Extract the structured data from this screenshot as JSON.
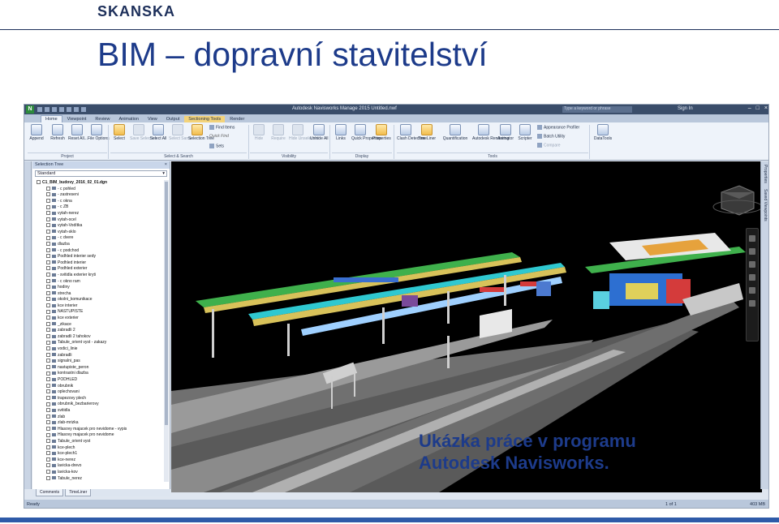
{
  "slide": {
    "logo": "SKANSKA",
    "title": "BIM – dopravní stavitelství",
    "caption_line1": "Ukázka práce v programu",
    "caption_line2": "Autodesk Navisworks.",
    "accent_color": "#1d3b8a"
  },
  "app": {
    "window_title": "Autodesk Navisworks Manage 2015   Untitled.nwf",
    "search_placeholder": "Type a keyword or phrase",
    "sign_in": "Sign In",
    "tabs": [
      "Home",
      "Viewpoint",
      "Review",
      "Animation",
      "View",
      "Output",
      "Sectioning Tools",
      "Render"
    ],
    "active_tab": "Home",
    "ribbon": {
      "buttons": [
        {
          "label": "Append",
          "state": "normal"
        },
        {
          "label": "Refresh",
          "state": "normal"
        },
        {
          "label": "Reset All...",
          "state": "normal"
        },
        {
          "label": "File Options",
          "state": "normal"
        },
        {
          "label": "Select",
          "state": "selected"
        },
        {
          "label": "Save Selection",
          "state": "dim"
        },
        {
          "label": "Select All",
          "state": "normal"
        },
        {
          "label": "Select Same",
          "state": "dim"
        },
        {
          "label": "Selection Tree",
          "state": "selected"
        },
        {
          "label": "Hide",
          "state": "dim"
        },
        {
          "label": "Require",
          "state": "dim"
        },
        {
          "label": "Hide Unselected",
          "state": "dim"
        },
        {
          "label": "Unhide All",
          "state": "normal"
        },
        {
          "label": "Links",
          "state": "normal"
        },
        {
          "label": "Quick Properties",
          "state": "normal"
        },
        {
          "label": "Properties",
          "state": "selected"
        },
        {
          "label": "Clash Detective",
          "state": "normal"
        },
        {
          "label": "TimeLiner",
          "state": "selected"
        },
        {
          "label": "Quantification",
          "state": "normal"
        },
        {
          "label": "Autodesk Rendering",
          "state": "normal"
        },
        {
          "label": "Animator",
          "state": "normal"
        },
        {
          "label": "Scripter",
          "state": "normal"
        },
        {
          "label": "DataTools",
          "state": "normal"
        }
      ],
      "find_items": "Find Items",
      "quick_find": "Quick Find",
      "sets": "Sets",
      "appearance_profiler": "Appearance Profiler",
      "batch_utility": "Batch Utility",
      "compare": "Compare",
      "groups": [
        "Project",
        "Select & Search",
        "Visibility",
        "Display",
        "Tools"
      ]
    },
    "selection_tree": {
      "header": "Selection Tree",
      "dropdown_value": "Standard",
      "root": "C1_BIM_budovy_2016_02_01.dgn",
      "items": [
        "- c pohled",
        "- zastreseni",
        "- c okna",
        "- c ZB",
        "vytah-nerez",
        "vytah-ocel",
        "vytah-Vodítka",
        "vytah-sklo",
        "- c dvere",
        "dlazba",
        "- c podchod",
        "Podhled interier sedy",
        "Podhled interier",
        "Podhled exterier",
        "- svitidla exterier kryti",
        "- c okno ram",
        "hodiny",
        "strecha",
        "okolni_komunikace",
        "kce interier",
        "NASTUPISTE",
        "kce exterier",
        "_zikace",
        "zabradli 2",
        "zabradli 2 tahokov",
        "Tabule_orient vyst - zakazy",
        "vodici_linie",
        "zabradli",
        "signalni_pas",
        "nastupiste_peron",
        "kontrastni dlazba",
        "PODHLED",
        "obrubnik",
        "oplechovani",
        "trapezovy plech",
        "obrubnik_bezbarierovy",
        "svitidla",
        "zlab",
        "zlab-mrizka",
        "Hlasovy majacek pro nevidome - vypis",
        "Hlasovy majacek pro nevidome",
        "Tabule_orient vyst",
        "kce-plech",
        "kce-plech1",
        "kce-nerez",
        "lavicka-drevo",
        "lavicka-kov",
        "Tabule_nerez"
      ]
    },
    "bottom_tabs": [
      "Comments",
      "TimeLiner"
    ],
    "right_tabs": [
      "Properties",
      "Saved Viewpoints"
    ],
    "status": "Ready",
    "page_indicator": "1 of 1",
    "memory": "403 MB"
  }
}
